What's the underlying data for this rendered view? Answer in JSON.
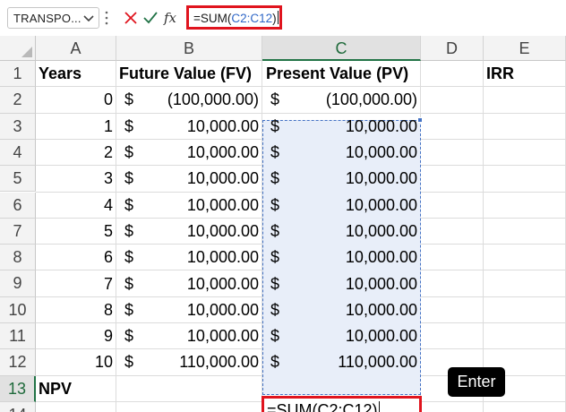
{
  "formula_bar": {
    "name_box": "TRANSPO...",
    "fx_label": "fx",
    "formula_prefix": "=SUM(",
    "formula_ref": "C2:C12",
    "formula_suffix": ")",
    "cancel_color": "#e0141e",
    "enter_color": "#217346"
  },
  "columns": [
    "A",
    "B",
    "C",
    "D",
    "E"
  ],
  "rows": [
    "1",
    "2",
    "3",
    "4",
    "5",
    "6",
    "7",
    "8",
    "9",
    "10",
    "11",
    "12",
    "13",
    "14"
  ],
  "headers": {
    "years": "Years",
    "fv": "Future Value (FV)",
    "pv": "Present Value (PV)",
    "irr": "IRR",
    "npv": "NPV"
  },
  "currency_symbol": "$",
  "years": [
    "0",
    "1",
    "2",
    "3",
    "4",
    "5",
    "6",
    "7",
    "8",
    "9",
    "10"
  ],
  "future_values": [
    "(100,000.00)",
    "10,000.00",
    "10,000.00",
    "10,000.00",
    "10,000.00",
    "10,000.00",
    "10,000.00",
    "10,000.00",
    "10,000.00",
    "10,000.00",
    "110,000.00"
  ],
  "present_values": [
    "(100,000.00)",
    "10,000.00",
    "10,000.00",
    "10,000.00",
    "10,000.00",
    "10,000.00",
    "10,000.00",
    "10,000.00",
    "10,000.00",
    "10,000.00",
    "110,000.00"
  ],
  "active_cell_text": "=SUM(C2:C12)",
  "tooltip": "Enter",
  "colors": {
    "highlight": "#e0141e",
    "selection_fill": "#e8eef9",
    "selection_border": "#4472c4",
    "active_header": "#217346"
  }
}
